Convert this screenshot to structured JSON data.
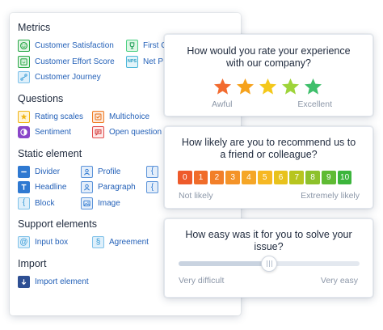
{
  "palette": {
    "metrics": {
      "title": "Metrics",
      "items": [
        {
          "label": "Customer Satisfaction",
          "icon": "smile-icon"
        },
        {
          "label": "First C",
          "icon": "trophy-icon"
        },
        {
          "label": "Customer Effort Score",
          "icon": "smile-box-icon"
        },
        {
          "label": "Net P",
          "icon": "nps-icon"
        },
        {
          "label": "Customer Journey",
          "icon": "journey-icon"
        }
      ]
    },
    "questions": {
      "title": "Questions",
      "items": [
        {
          "label": "Rating scales",
          "icon": "star-icon"
        },
        {
          "label": "Multichoice",
          "icon": "checkbox-icon"
        },
        {
          "label": "Sentiment",
          "icon": "sentiment-icon"
        },
        {
          "label": "Open question",
          "icon": "chat-icon"
        }
      ]
    },
    "static": {
      "title": "Static element",
      "items": [
        {
          "label": "Divider",
          "icon": "divider-icon"
        },
        {
          "label": "Profile",
          "icon": "profile-icon"
        },
        {
          "label": "",
          "icon": "brace-icon"
        },
        {
          "label": "Headline",
          "icon": "headline-icon"
        },
        {
          "label": "Paragraph",
          "icon": "paragraph-icon"
        },
        {
          "label": "",
          "icon": "brace-icon"
        },
        {
          "label": "Block",
          "icon": "block-icon"
        },
        {
          "label": "Image",
          "icon": "image-icon"
        }
      ]
    },
    "support": {
      "title": "Support elements",
      "items": [
        {
          "label": "Input box",
          "icon": "at-icon"
        },
        {
          "label": "Agreement",
          "icon": "section-icon"
        }
      ]
    },
    "import": {
      "title": "Import",
      "items": [
        {
          "label": "Import element",
          "icon": "import-icon"
        }
      ]
    }
  },
  "cards": {
    "rating": {
      "question": "How would you rate your experience with our company?",
      "stars": 5,
      "star_colors": [
        "#f26b2f",
        "#f6a21c",
        "#f4c81a",
        "#9ed43a",
        "#3fbf6b"
      ],
      "min_label": "Awful",
      "max_label": "Excellent"
    },
    "nps": {
      "question": "How likely are you to recommend us to a friend or colleague?",
      "values": [
        "0",
        "1",
        "2",
        "3",
        "4",
        "5",
        "6",
        "7",
        "8",
        "9",
        "10"
      ],
      "colors": [
        "#ee5a2b",
        "#f06c2a",
        "#f27f29",
        "#f49328",
        "#f5a627",
        "#f6b823",
        "#e8c21c",
        "#b7c51f",
        "#8dc12b",
        "#5fbb34",
        "#3cb53c"
      ],
      "min_label": "Not likely",
      "max_label": "Extremely likely"
    },
    "effort": {
      "question": "How easy was it for you to solve your issue?",
      "slider_value": 0.5,
      "min_label": "Very difficult",
      "max_label": "Very easy"
    }
  },
  "colors": {
    "link": "#2461b8",
    "heading": "#1f2a3d",
    "muted": "#8c97a8"
  }
}
